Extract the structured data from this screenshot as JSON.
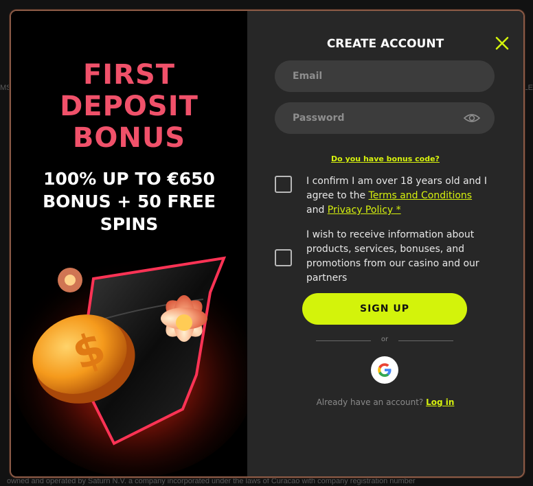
{
  "background": {
    "left_fragment": "MS",
    "right_fragment": "LE",
    "footer_text": "owned and operated by Saturn N.V. a company incorporated under the laws of Curacao with company registration number"
  },
  "promo": {
    "title_lines": [
      "FIRST",
      "DEPOSIT",
      "BONUS"
    ],
    "offer_lines": [
      "100% UP TO €650",
      "BONUS + 50 FREE",
      "SPINS"
    ]
  },
  "form": {
    "title": "CREATE ACCOUNT",
    "close_icon": "close-icon",
    "email_placeholder": "Email",
    "password_placeholder": "Password",
    "bonus_code_link": "Do you have bonus code?",
    "age_confirm": {
      "prefix": "I confirm I am over 18 years old and I agree to the ",
      "terms_link": "Terms and Conditions",
      "middle": " and ",
      "privacy_link": "Privacy Policy *"
    },
    "marketing_consent": "I wish to receive information about products, services, bonuses, and promotions from our casino and our partners",
    "signup_label": "SIGN UP",
    "or_label": "or",
    "google_icon": "google-icon",
    "already_text": "Already have an account? ",
    "login_label": "Log in"
  },
  "colors": {
    "accent": "#d3f30b",
    "promo_title": "#f0516a",
    "panel": "#272727",
    "field": "#3c3c3c"
  }
}
